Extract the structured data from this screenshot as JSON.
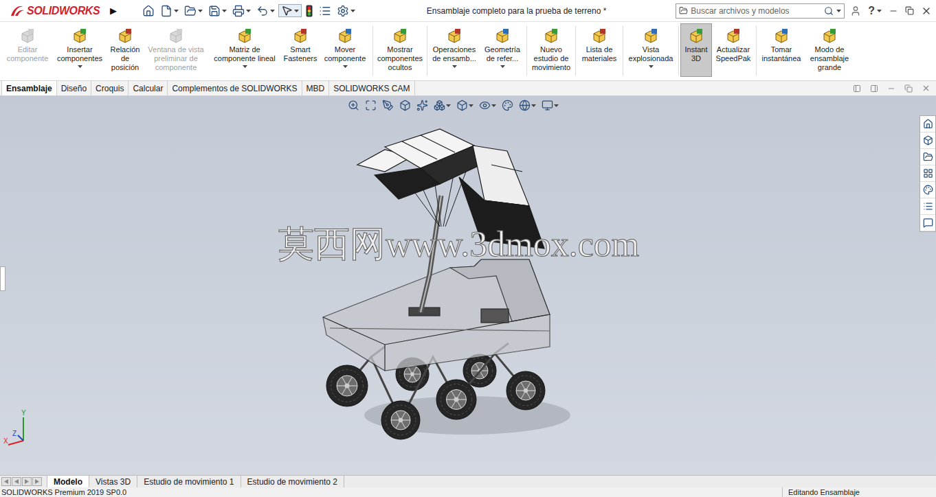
{
  "app": {
    "logo": "SOLIDWORKS",
    "menu_toggle": "▶"
  },
  "window": {
    "title": "Ensamblaje completo para la prueba de terreno *"
  },
  "search": {
    "placeholder": "Buscar archivos y modelos"
  },
  "help": "?",
  "ribbon": [
    {
      "label": "Editar componente",
      "disabled": true,
      "dropdown": false,
      "selected": false
    },
    {
      "label": "Insertar componentes",
      "disabled": false,
      "dropdown": true,
      "selected": false
    },
    {
      "label": "Relación de posición",
      "disabled": false,
      "dropdown": false,
      "selected": false
    },
    {
      "label": "Ventana de vista preliminar de componente",
      "disabled": true,
      "dropdown": false,
      "selected": false
    },
    {
      "label": "Matriz de componente lineal",
      "disabled": false,
      "dropdown": true,
      "selected": false
    },
    {
      "label": "Smart Fasteners",
      "disabled": false,
      "dropdown": false,
      "selected": false
    },
    {
      "label": "Mover componente",
      "disabled": false,
      "dropdown": true,
      "selected": false
    },
    {
      "label": "Mostrar componentes ocultos",
      "disabled": false,
      "dropdown": false,
      "selected": false
    },
    {
      "label": "Operaciones de ensamb...",
      "disabled": false,
      "dropdown": true,
      "selected": false
    },
    {
      "label": "Geometría de refer...",
      "disabled": false,
      "dropdown": true,
      "selected": false
    },
    {
      "label": "Nuevo estudio de movimiento",
      "disabled": false,
      "dropdown": false,
      "selected": false
    },
    {
      "label": "Lista de materiales",
      "disabled": false,
      "dropdown": false,
      "selected": false
    },
    {
      "label": "Vista explosionada",
      "disabled": false,
      "dropdown": true,
      "selected": false
    },
    {
      "label": "Instant 3D",
      "disabled": false,
      "dropdown": false,
      "selected": true
    },
    {
      "label": "Actualizar SpeedPak",
      "disabled": false,
      "dropdown": false,
      "selected": false
    },
    {
      "label": "Tomar instantánea",
      "disabled": false,
      "dropdown": false,
      "selected": false
    },
    {
      "label": "Modo de ensamblaje grande",
      "disabled": false,
      "dropdown": false,
      "selected": false
    }
  ],
  "tabs": [
    {
      "label": "Ensamblaje",
      "selected": true
    },
    {
      "label": "Diseño",
      "selected": false
    },
    {
      "label": "Croquis",
      "selected": false
    },
    {
      "label": "Calcular",
      "selected": false
    },
    {
      "label": "Complementos de SOLIDWORKS",
      "selected": false
    },
    {
      "label": "MBD",
      "selected": false
    },
    {
      "label": "SOLIDWORKS CAM",
      "selected": false
    }
  ],
  "viewport": {
    "watermark": "莫西网www.3dmox.com",
    "triad": {
      "x": "X",
      "y": "Y",
      "z": "Z"
    }
  },
  "bottom_tabs": [
    {
      "label": "Modelo",
      "selected": true
    },
    {
      "label": "Vistas 3D",
      "selected": false
    },
    {
      "label": "Estudio de movimiento 1",
      "selected": false
    },
    {
      "label": "Estudio de movimiento 2",
      "selected": false
    }
  ],
  "status_bar": {
    "product": "SOLIDWORKS Premium 2019 SP0.0",
    "mode": "Editando Ensamblaje"
  }
}
